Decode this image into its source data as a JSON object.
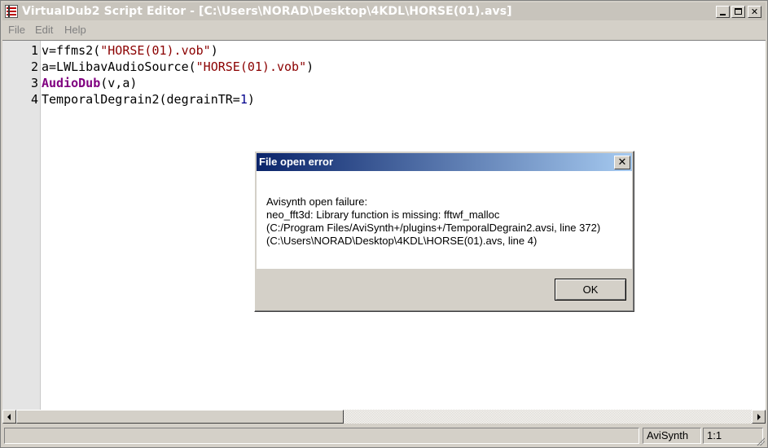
{
  "window": {
    "title": "VirtualDub2 Script Editor - [C:\\Users\\NORAD\\Desktop\\4KDL\\HORSE(01).avs]",
    "controls": {
      "minimize": "_",
      "maximize": "□",
      "close": "×"
    }
  },
  "menu": {
    "items": [
      {
        "label": "File"
      },
      {
        "label": "Edit"
      },
      {
        "label": "Help"
      }
    ]
  },
  "editor": {
    "lines": [
      {
        "number": "1",
        "segments": [
          {
            "t": "v=ffms2(",
            "c": ""
          },
          {
            "t": "\"HORSE(01).vob\"",
            "c": "str"
          },
          {
            "t": ")",
            "c": ""
          }
        ]
      },
      {
        "number": "2",
        "segments": [
          {
            "t": "a=LWLibavAudioSource(",
            "c": ""
          },
          {
            "t": "\"HORSE(01).vob\"",
            "c": "str"
          },
          {
            "t": ")",
            "c": ""
          }
        ]
      },
      {
        "number": "3",
        "segments": [
          {
            "t": "AudioDub",
            "c": "kw"
          },
          {
            "t": "(v,a)",
            "c": ""
          }
        ]
      },
      {
        "number": "4",
        "segments": [
          {
            "t": "TemporalDegrain2(degrainTR=",
            "c": ""
          },
          {
            "t": "1",
            "c": "num"
          },
          {
            "t": ")",
            "c": ""
          }
        ]
      }
    ]
  },
  "statusbar": {
    "message": "",
    "language": "AviSynth",
    "position": "1:1"
  },
  "dialog": {
    "title": "File open error",
    "close_glyph": "✕",
    "message_lines": [
      "Avisynth open failure:",
      "neo_fft3d: Library function is missing: fftwf_malloc",
      "(C:/Program Files/AviSynth+/plugins+/TemporalDegrain2.avsi, line 372)",
      "(C:\\Users\\NORAD\\Desktop\\4KDL\\HORSE(01).avs, line 4)"
    ],
    "ok_label": "OK"
  },
  "colors": {
    "string": "#8b0000",
    "number": "#00008b",
    "keyword": "#800080",
    "dialog_title_start": "#0a246a",
    "dialog_title_end": "#a6caf0"
  }
}
